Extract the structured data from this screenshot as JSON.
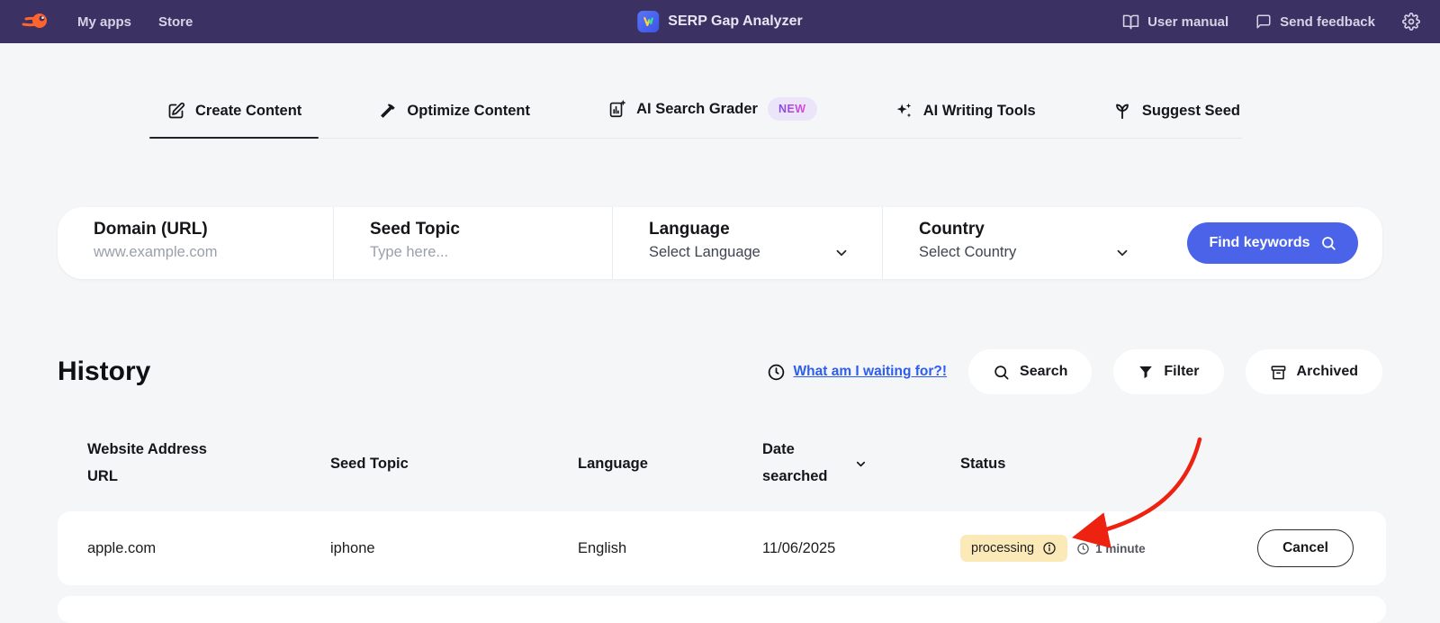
{
  "topbar": {
    "my_apps": "My apps",
    "store": "Store",
    "app_title": "SERP Gap Analyzer",
    "user_manual": "User manual",
    "send_feedback": "Send feedback"
  },
  "tabs": [
    {
      "label": "Create Content",
      "active": true
    },
    {
      "label": "Optimize Content",
      "active": false
    },
    {
      "label": "AI Search Grader",
      "active": false,
      "badge": "NEW"
    },
    {
      "label": "AI Writing Tools",
      "active": false
    },
    {
      "label": "Suggest Seed",
      "active": false
    }
  ],
  "form": {
    "fields": [
      {
        "label": "Domain (URL)",
        "placeholder": "www.example.com",
        "type": "input"
      },
      {
        "label": "Seed Topic",
        "placeholder": "Type here...",
        "type": "input"
      },
      {
        "label": "Language",
        "value": "Select Language",
        "type": "select"
      },
      {
        "label": "Country",
        "value": "Select Country",
        "type": "select"
      }
    ],
    "submit_label": "Find keywords"
  },
  "history": {
    "title": "History",
    "waiting_link": "What am I waiting for?!",
    "actions": {
      "search": "Search",
      "filter": "Filter",
      "archived": "Archived"
    },
    "table": {
      "columns": [
        "Website Address URL",
        "Seed Topic",
        "Language",
        "Date searched",
        "Status"
      ],
      "rows": [
        {
          "url": "apple.com",
          "seed": "iphone",
          "language": "English",
          "date": "11/06/2025",
          "status": "processing",
          "eta": "1 minute",
          "action": "Cancel"
        }
      ]
    }
  },
  "colors": {
    "topbar_bg": "#3b3162",
    "accent_blue": "#4a63e8",
    "link_blue": "#2d5cf0",
    "processing_badge_bg": "#fbe9b8",
    "new_badge_bg": "#ece5fa",
    "arrow_red": "#ee2211",
    "page_bg": "#f5f6f8"
  }
}
